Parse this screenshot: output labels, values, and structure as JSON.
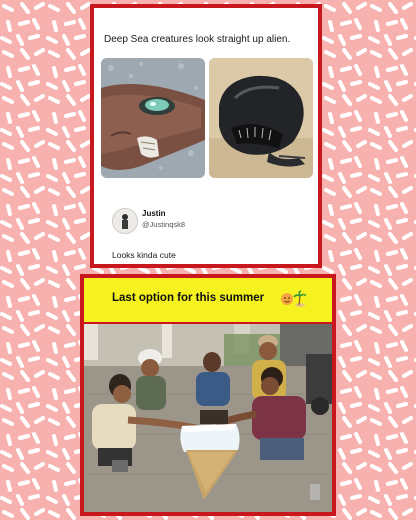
{
  "tweet": {
    "text": "Deep Sea creatures look straight up alien."
  },
  "reply": {
    "name": "Justin",
    "handle": "@Justinqsk8",
    "text": "Looks kinda cute"
  },
  "video": {
    "banner_text": "Last option for this summer"
  },
  "colors": {
    "background": "#f7b2b0",
    "frame_red": "#c8181d",
    "banner_yellow": "#f6f21f"
  }
}
